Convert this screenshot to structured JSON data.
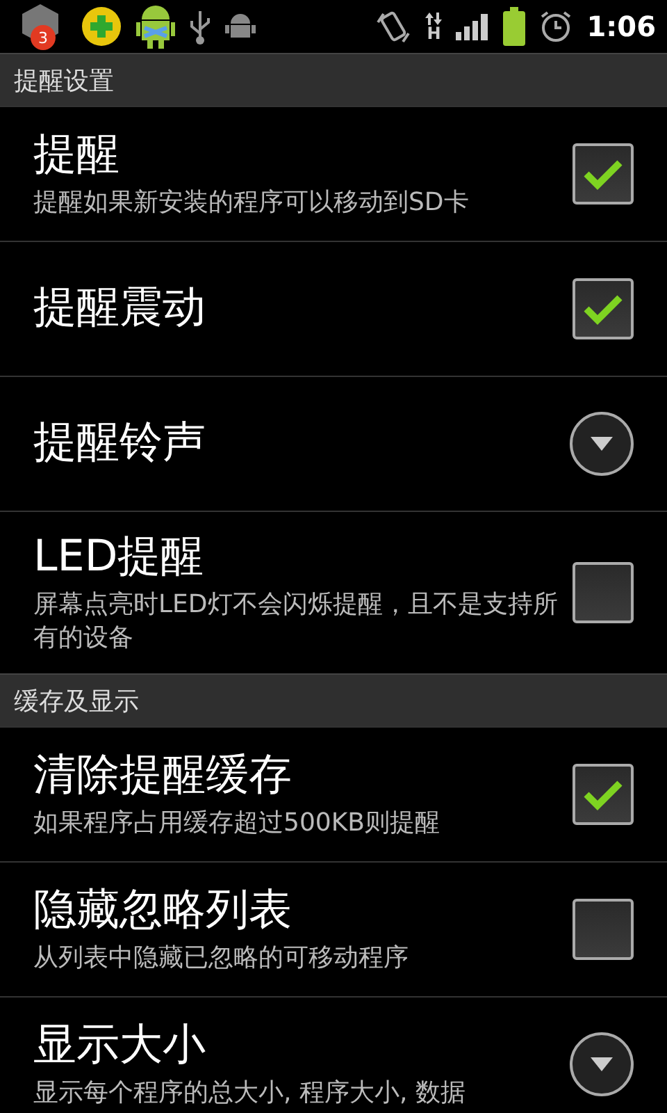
{
  "status_bar": {
    "notification_count": "3",
    "network_type": "H",
    "time": "1:06"
  },
  "sections": [
    {
      "title": "提醒设置",
      "items": [
        {
          "kind": "checkbox",
          "title": "提醒",
          "summary": "提醒如果新安装的程序可以移动到SD卡",
          "checked": true
        },
        {
          "kind": "checkbox",
          "title": "提醒震动",
          "checked": true
        },
        {
          "kind": "dropdown",
          "title": "提醒铃声"
        },
        {
          "kind": "checkbox",
          "title": "LED提醒",
          "summary": "屏幕点亮时LED灯不会闪烁提醒，且不是支持所有的设备",
          "checked": false
        }
      ]
    },
    {
      "title": "缓存及显示",
      "items": [
        {
          "kind": "checkbox",
          "title": "清除提醒缓存",
          "summary": "如果程序占用缓存超过500KB则提醒",
          "checked": true
        },
        {
          "kind": "checkbox",
          "title": "隐藏忽略列表",
          "summary": "从列表中隐藏已忽略的可移动程序",
          "checked": false
        },
        {
          "kind": "dropdown",
          "title": "显示大小",
          "summary": "显示每个程序的总大小, 程序大小, 数据"
        }
      ]
    }
  ]
}
